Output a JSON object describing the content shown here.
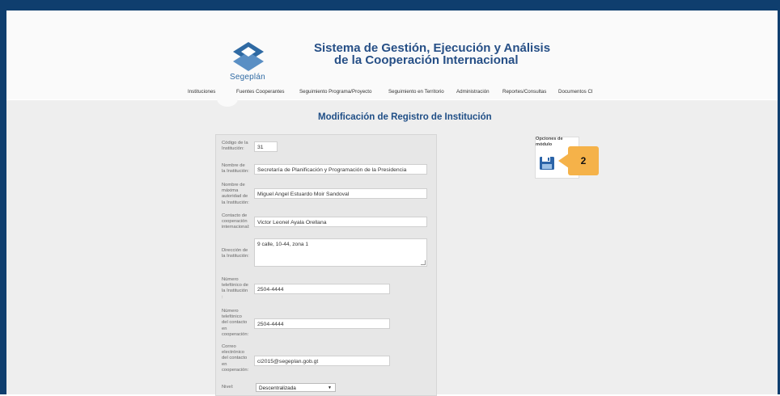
{
  "header": {
    "logo_text": "Segeplán",
    "title_line1": "Sistema de Gestión, Ejecución y Análisis",
    "title_line2": "de la Cooperación Internacional"
  },
  "nav": {
    "items": [
      "Instituciones",
      "Fuentes Cooperantes",
      "Seguimiento Programa/Proyecto",
      "Seguimiento en Territorio",
      "Administración",
      "Reportes/Consultas",
      "Documentos CI"
    ]
  },
  "page": {
    "title": "Modificación de Registro de Institución"
  },
  "form": {
    "codigo_label": "Código de la\nInstitución:",
    "codigo_value": "31",
    "nombre_label": "Nombre de\nla Institución:",
    "nombre_value": "Secretaría de Planificación y Programación de la Presidencia",
    "autoridad_label": "Nombre de\nmáxima\nautoridad de\nla Institución:",
    "autoridad_value": "Miguel Angel Estuardo Moir Sandoval",
    "contacto_label": "Contacto de\ncooperación\ninternacional:",
    "contacto_value": "Victor Leonel Ayala Orellana",
    "direccion_label": "Dirección de\nla Institución:",
    "direccion_value": "9 calle, 10-44, zona 1",
    "tel_inst_label": "Número\ntelefónico de\nla Institución\n:",
    "tel_inst_value": "2504-4444",
    "tel_contacto_label": "Número\ntelefónico\ndel contacto\nen\ncooperación:",
    "tel_contacto_value": "2504-4444",
    "correo_label": "Correo\nelectrónico\ndel contacto\nen\ncooperación:",
    "correo_value": "ci2015@segeplan.gob.gt",
    "nivel_label": "Nivel:",
    "nivel_value": "Descentralizada"
  },
  "options": {
    "title": "Opciones de\nmódulo",
    "save_icon": "floppy-disk-icon"
  },
  "callout": {
    "number": "2",
    "color": "#f5b249"
  },
  "colors": {
    "frame": "#0f3e6e",
    "title": "#264f86"
  }
}
